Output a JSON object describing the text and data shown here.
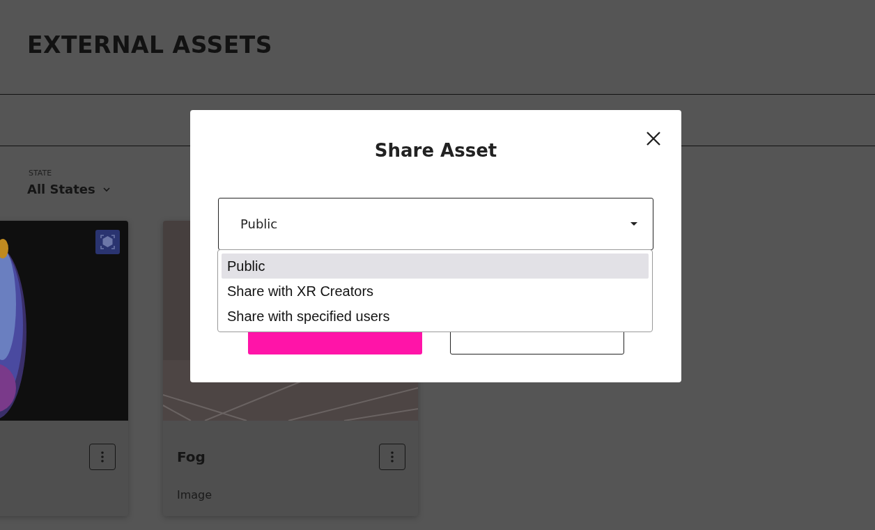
{
  "page": {
    "title": "EXTERNAL ASSETS"
  },
  "filter": {
    "label": "STATE",
    "value": "All States"
  },
  "cards": [
    {
      "kind": "model",
      "badge": true
    },
    {
      "badge": false,
      "title": "Fog",
      "type": "Image"
    }
  ],
  "dialog": {
    "title": "Share Asset",
    "select": {
      "value": "Public",
      "expanded": true,
      "options": [
        {
          "label": "Public",
          "selected": true
        },
        {
          "label": "Share with XR Creators",
          "selected": false
        },
        {
          "label": "Share with specified users",
          "selected": false
        }
      ]
    },
    "buttons": [
      {
        "kind": "primary"
      },
      {
        "kind": "secondary"
      }
    ]
  }
}
